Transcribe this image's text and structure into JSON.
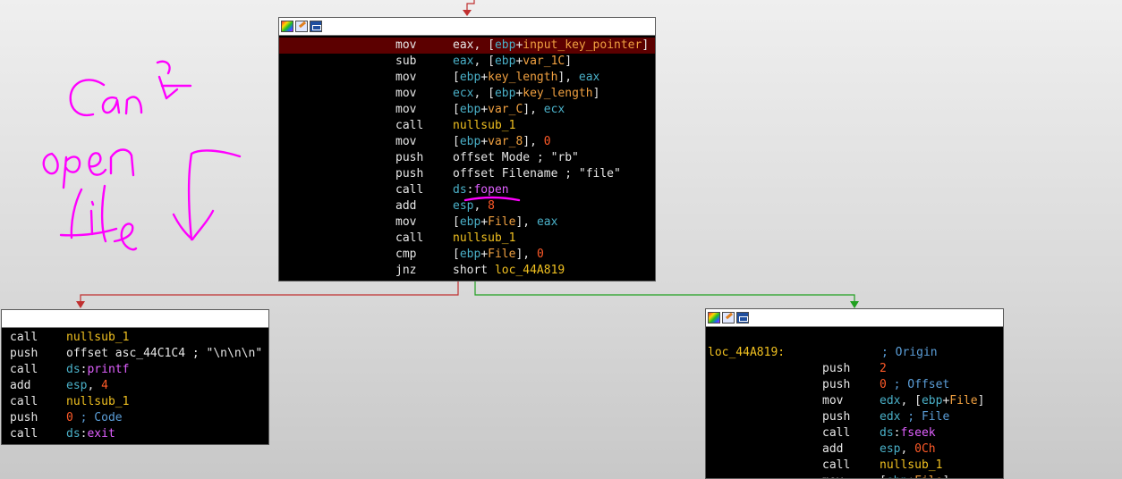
{
  "annotation": {
    "handwriting": [
      "Can't",
      "open",
      "file"
    ]
  },
  "blocks": {
    "main": {
      "lines": [
        {
          "ins": "mov",
          "ops": [
            [
              "t",
              "eax, ["
            ],
            [
              "r",
              "ebp"
            ],
            [
              "t",
              "+"
            ],
            [
              "v",
              "input_key_pointer"
            ],
            [
              "t",
              "]"
            ]
          ],
          "highlight": true
        },
        {
          "ins": "sub",
          "ops": [
            [
              "r",
              "eax"
            ],
            [
              "t",
              ", ["
            ],
            [
              "r",
              "ebp"
            ],
            [
              "t",
              "+"
            ],
            [
              "v",
              "var_1C"
            ],
            [
              "t",
              "]"
            ]
          ]
        },
        {
          "ins": "mov",
          "ops": [
            [
              "t",
              "["
            ],
            [
              "r",
              "ebp"
            ],
            [
              "t",
              "+"
            ],
            [
              "v",
              "key_length"
            ],
            [
              "t",
              "], "
            ],
            [
              "r",
              "eax"
            ]
          ]
        },
        {
          "ins": "mov",
          "ops": [
            [
              "r",
              "ecx"
            ],
            [
              "t",
              ", ["
            ],
            [
              "r",
              "ebp"
            ],
            [
              "t",
              "+"
            ],
            [
              "v",
              "key_length"
            ],
            [
              "t",
              "]"
            ]
          ]
        },
        {
          "ins": "mov",
          "ops": [
            [
              "t",
              "["
            ],
            [
              "r",
              "ebp"
            ],
            [
              "t",
              "+"
            ],
            [
              "v",
              "var_C"
            ],
            [
              "t",
              "], "
            ],
            [
              "r",
              "ecx"
            ]
          ]
        },
        {
          "ins": "call",
          "ops": [
            [
              "lb",
              "nullsub_1"
            ]
          ]
        },
        {
          "ins": "mov",
          "ops": [
            [
              "t",
              "["
            ],
            [
              "r",
              "ebp"
            ],
            [
              "t",
              "+"
            ],
            [
              "v",
              "var_8"
            ],
            [
              "t",
              "], "
            ],
            [
              "n",
              "0"
            ]
          ]
        },
        {
          "ins": "push",
          "ops": [
            [
              "t",
              "offset Mode ; \"rb\""
            ]
          ]
        },
        {
          "ins": "push",
          "ops": [
            [
              "t",
              "offset Filename ; \"file\""
            ]
          ]
        },
        {
          "ins": "call",
          "ops": [
            [
              "r",
              "ds"
            ],
            [
              "t",
              ":"
            ],
            [
              "mg",
              "fopen"
            ]
          ]
        },
        {
          "ins": "add",
          "ops": [
            [
              "r",
              "esp"
            ],
            [
              "t",
              ", "
            ],
            [
              "n",
              "8"
            ]
          ]
        },
        {
          "ins": "mov",
          "ops": [
            [
              "t",
              "["
            ],
            [
              "r",
              "ebp"
            ],
            [
              "t",
              "+"
            ],
            [
              "v",
              "File"
            ],
            [
              "t",
              "], "
            ],
            [
              "r",
              "eax"
            ]
          ]
        },
        {
          "ins": "call",
          "ops": [
            [
              "lb",
              "nullsub_1"
            ]
          ]
        },
        {
          "ins": "cmp",
          "ops": [
            [
              "t",
              "["
            ],
            [
              "r",
              "ebp"
            ],
            [
              "t",
              "+"
            ],
            [
              "v",
              "File"
            ],
            [
              "t",
              "], "
            ],
            [
              "n",
              "0"
            ]
          ]
        },
        {
          "ins": "jnz",
          "ops": [
            [
              "t",
              "short "
            ],
            [
              "lb",
              "loc_44A819"
            ]
          ]
        }
      ]
    },
    "left": {
      "lines": [
        {
          "ins": "call",
          "ops": [
            [
              "lb",
              "nullsub_1"
            ]
          ]
        },
        {
          "ins": "push",
          "ops": [
            [
              "t",
              "offset asc_44C1C4 ; \"\\n\\n\\n\""
            ]
          ]
        },
        {
          "ins": "call",
          "ops": [
            [
              "r",
              "ds"
            ],
            [
              "t",
              ":"
            ],
            [
              "mg",
              "printf"
            ]
          ]
        },
        {
          "ins": "add",
          "ops": [
            [
              "r",
              "esp"
            ],
            [
              "t",
              ", "
            ],
            [
              "n",
              "4"
            ]
          ]
        },
        {
          "ins": "call",
          "ops": [
            [
              "lb",
              "nullsub_1"
            ]
          ]
        },
        {
          "ins": "push",
          "ops": [
            [
              "n",
              "0"
            ],
            [
              "c",
              " ; Code"
            ]
          ]
        },
        {
          "ins": "call",
          "ops": [
            [
              "r",
              "ds"
            ],
            [
              "t",
              ":"
            ],
            [
              "mg",
              "exit"
            ]
          ]
        }
      ]
    },
    "right": {
      "label": "loc_44A819:",
      "label_comment": "; Origin",
      "lines": [
        {
          "ins": "push",
          "ops": [
            [
              "n",
              "2"
            ]
          ]
        },
        {
          "ins": "push",
          "ops": [
            [
              "n",
              "0"
            ],
            [
              "c",
              " ; Offset"
            ]
          ]
        },
        {
          "ins": "mov",
          "ops": [
            [
              "r",
              "edx"
            ],
            [
              "t",
              ", ["
            ],
            [
              "r",
              "ebp"
            ],
            [
              "t",
              "+"
            ],
            [
              "v",
              "File"
            ],
            [
              "t",
              "]"
            ]
          ]
        },
        {
          "ins": "push",
          "ops": [
            [
              "r",
              "edx"
            ],
            [
              "c",
              " ; File"
            ]
          ]
        },
        {
          "ins": "call",
          "ops": [
            [
              "r",
              "ds"
            ],
            [
              "t",
              ":"
            ],
            [
              "mg",
              "fseek"
            ]
          ]
        },
        {
          "ins": "add",
          "ops": [
            [
              "r",
              "esp"
            ],
            [
              "t",
              ", "
            ],
            [
              "n",
              "0Ch"
            ]
          ]
        },
        {
          "ins": "call",
          "ops": [
            [
              "lb",
              "nullsub_1"
            ]
          ]
        },
        {
          "ins": "mov",
          "ops": [
            [
              "t",
              "["
            ],
            [
              "r",
              "ebp"
            ],
            [
              "t",
              "+"
            ],
            [
              "v",
              "File"
            ],
            [
              "t",
              "]"
            ]
          ]
        }
      ]
    }
  }
}
